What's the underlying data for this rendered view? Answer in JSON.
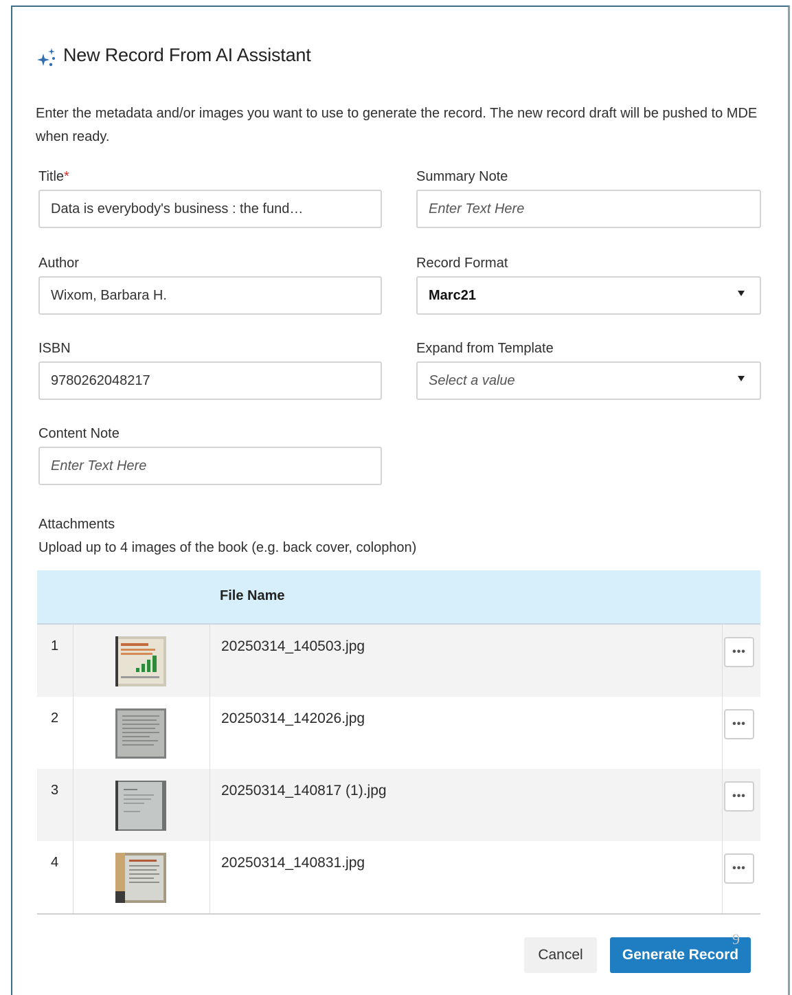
{
  "dialog": {
    "title": "New Record From AI Assistant",
    "description": "Enter the metadata and/or images you want to use to generate the record. The new record draft will be pushed to MDE when ready."
  },
  "fields": {
    "title": {
      "label": "Title",
      "required_mark": "*",
      "value": "Data is everybody's business : the fund…"
    },
    "summary_note": {
      "label": "Summary Note",
      "placeholder": "Enter Text Here"
    },
    "author": {
      "label": "Author",
      "value": "Wixom, Barbara H."
    },
    "record_format": {
      "label": "Record Format",
      "value": "Marc21"
    },
    "isbn": {
      "label": "ISBN",
      "value": "9780262048217"
    },
    "expand_template": {
      "label": "Expand from Template",
      "placeholder": "Select a value"
    },
    "content_note": {
      "label": "Content Note",
      "placeholder": "Enter Text Here"
    }
  },
  "attachments": {
    "title": "Attachments",
    "subtitle": "Upload up to 4 images of the book (e.g. back cover, colophon)",
    "column_file_name": "File Name",
    "more_label": "•••",
    "rows": [
      {
        "num": "1",
        "file": "20250314_140503.jpg"
      },
      {
        "num": "2",
        "file": "20250314_142026.jpg"
      },
      {
        "num": "3",
        "file": "20250314_140817 (1).jpg"
      },
      {
        "num": "4",
        "file": "20250314_140831.jpg"
      }
    ]
  },
  "footer": {
    "cancel_label": "Cancel",
    "generate_label": "Generate Record",
    "page_number": "9"
  },
  "colors": {
    "primary": "#1f7ec1",
    "header_bg": "#d7eefb",
    "required": "#d32f2f"
  }
}
